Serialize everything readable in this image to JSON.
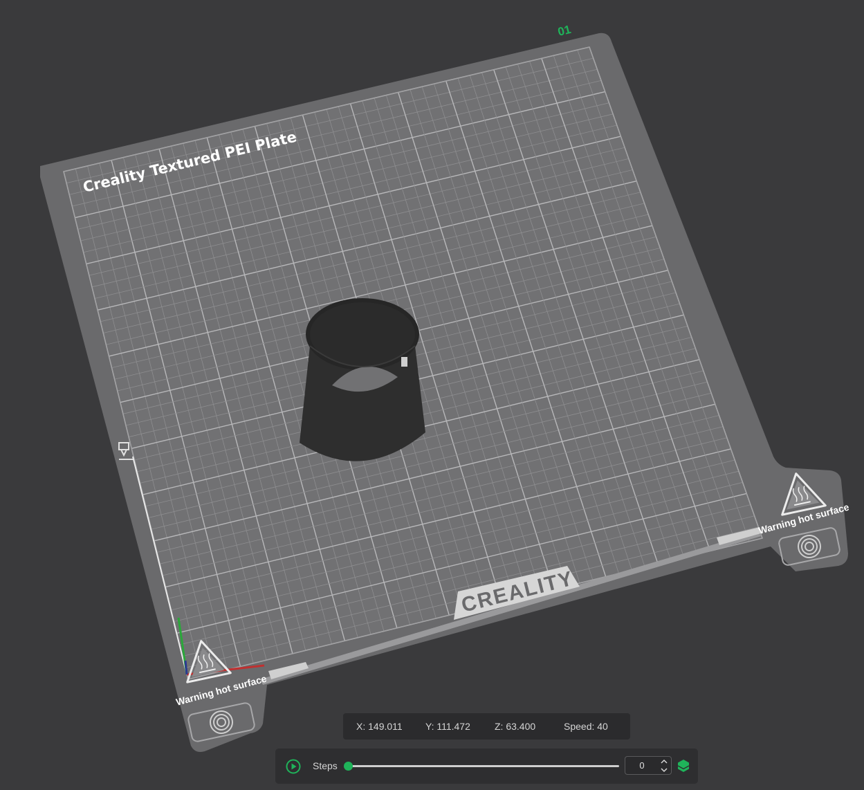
{
  "plate": {
    "label": "Creality Textured PEI Plate",
    "number": "01",
    "brand": "CREALITY",
    "warning_left": "Warning hot surface",
    "warning_right": "Warning hot surface"
  },
  "status": {
    "x": "X: 149.011",
    "y": "Y: 111.472",
    "z": "Z: 63.400",
    "speed": "Speed: 40"
  },
  "controls": {
    "steps_label": "Steps",
    "step_value": "0",
    "slider_fraction": 0
  },
  "colors": {
    "background": "#3a3a3c",
    "plate": "#6b6b6d",
    "grid": "#9c9c9e",
    "accent_green": "#1fb45a",
    "axis_x": "#c03030",
    "axis_y": "#2aa83a",
    "axis_z": "#2a3a90"
  },
  "icons": {
    "play": "play-circle-icon",
    "layers": "layers-icon",
    "heat_warning": "hot-surface-warning-icon",
    "fingerprint": "fingerprint-icon",
    "nozzle": "nozzle-icon"
  }
}
